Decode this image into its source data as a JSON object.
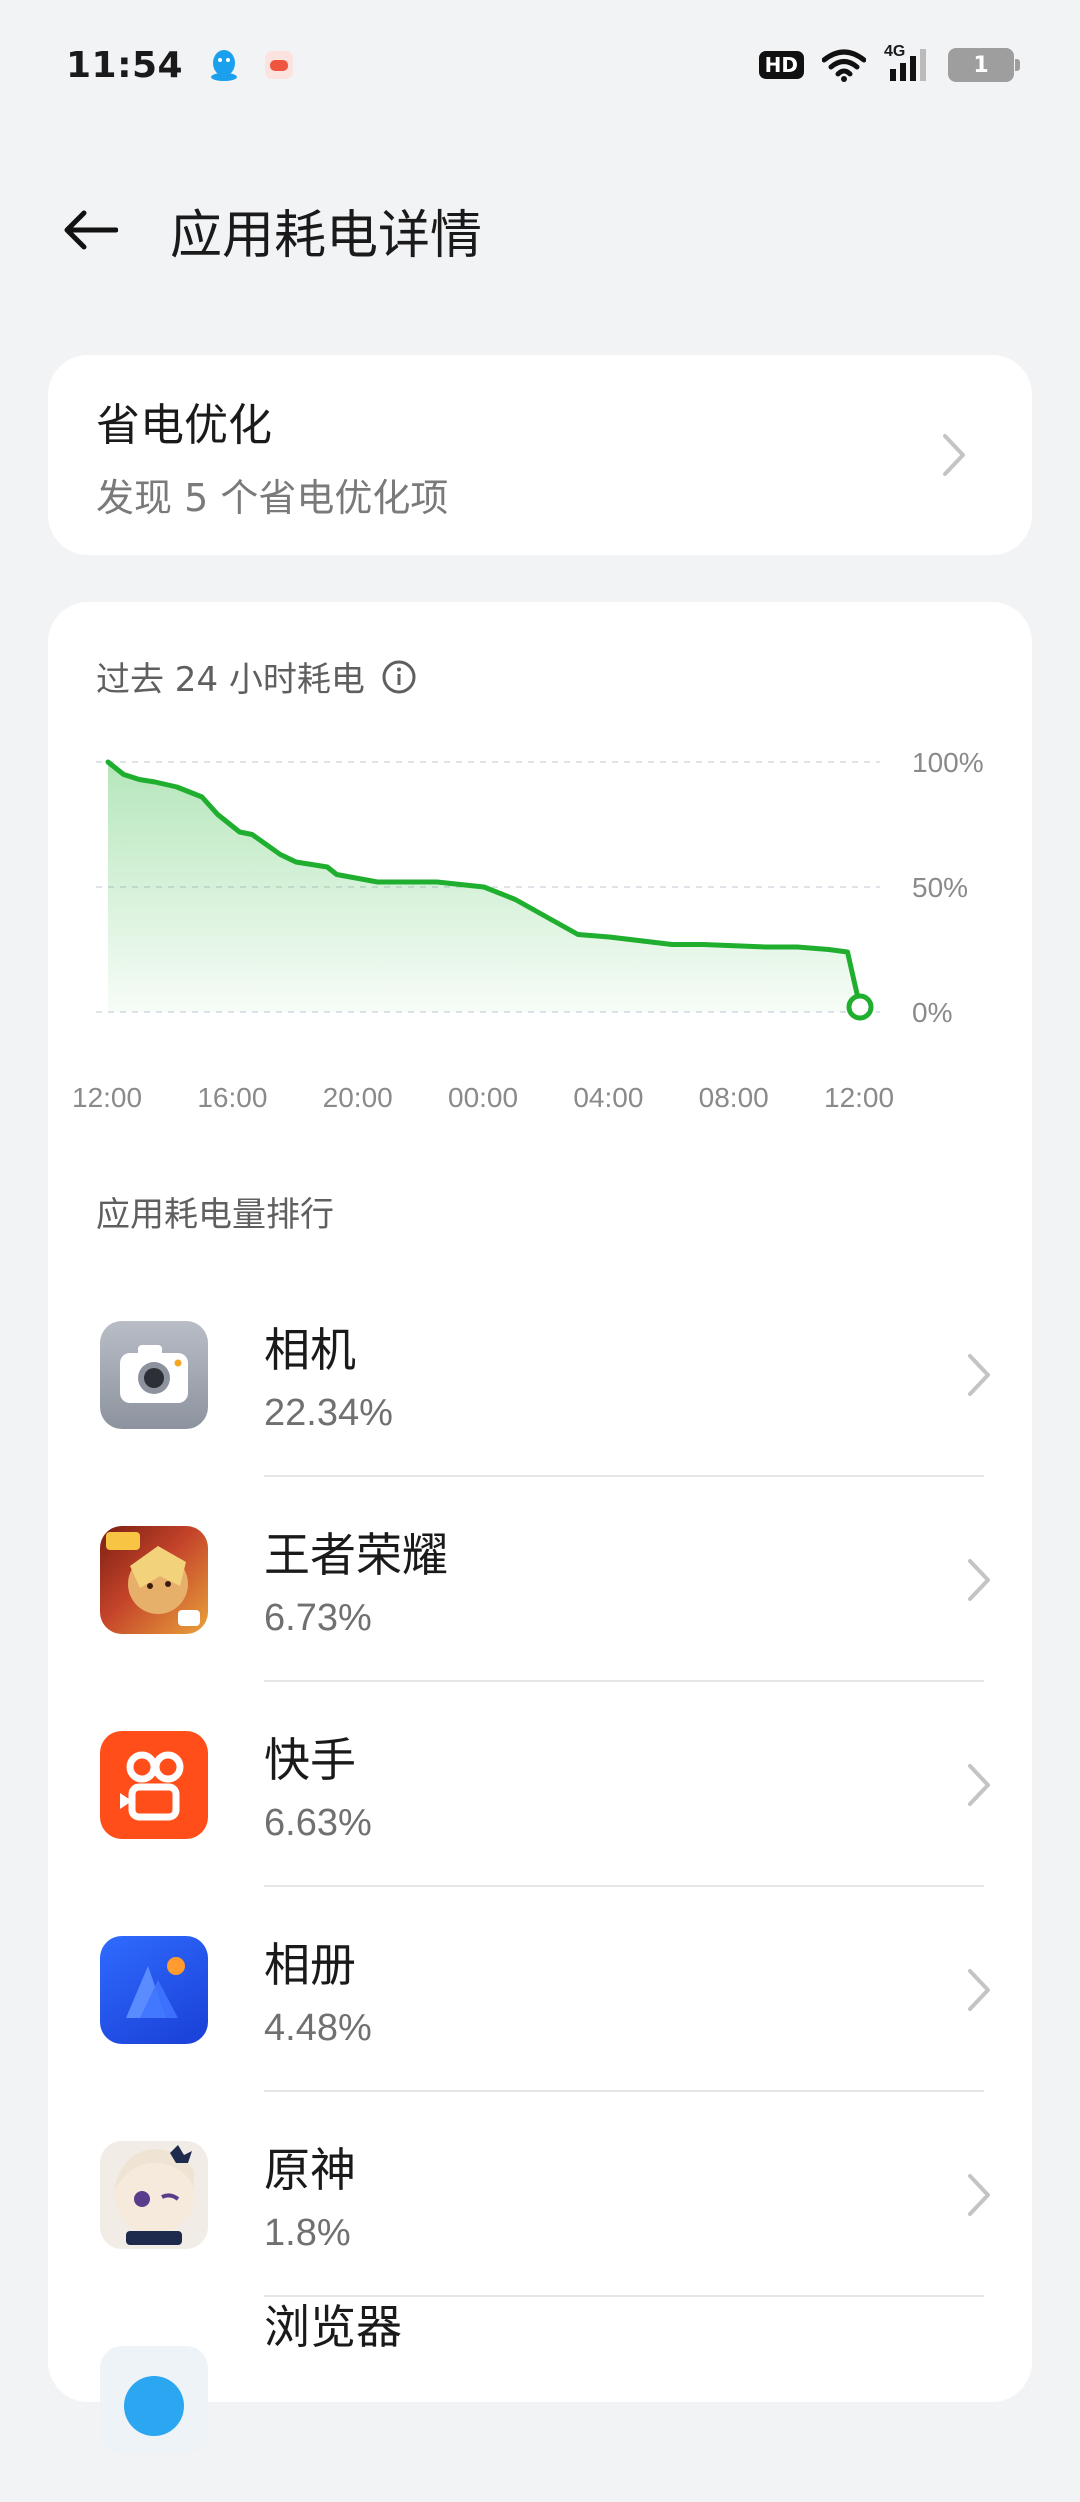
{
  "status_bar": {
    "time": "11:54",
    "hd": "HD",
    "network": "4G",
    "battery_level": "1",
    "icons": [
      "qq-icon",
      "game-app-icon",
      "wifi-icon",
      "signal-icon"
    ]
  },
  "header": {
    "title": "应用耗电详情",
    "back_icon": "back-arrow-icon"
  },
  "optimization": {
    "title": "省电优化",
    "subtitle": "发现 5 个省电优化项"
  },
  "usage": {
    "label": "过去 24 小时耗电",
    "info_icon": "info-icon"
  },
  "chart_data": {
    "type": "area",
    "x_ticks": [
      "12:00",
      "16:00",
      "20:00",
      "00:00",
      "04:00",
      "08:00",
      "12:00"
    ],
    "y_ticks": [
      "100%",
      "50%",
      "0%"
    ],
    "ylim": [
      0,
      100
    ],
    "xlim": [
      0,
      24
    ],
    "line_color": "#1fae2e",
    "grid": true,
    "series": [
      {
        "x": [
          0,
          0.5,
          1,
          1.5,
          2.2,
          3,
          3.5,
          4.2,
          4.6,
          5.5,
          6,
          7,
          7.3,
          8.6,
          9,
          9.6,
          10.5,
          12,
          13,
          15,
          16,
          18,
          19,
          21,
          22,
          23,
          23.6,
          24
        ],
        "y": [
          100,
          95,
          93,
          92,
          90,
          86,
          79,
          72,
          71,
          63,
          60,
          58,
          55,
          52,
          52,
          52,
          52,
          50,
          45,
          31,
          30,
          27,
          27,
          26,
          26,
          25,
          24,
          2
        ]
      }
    ]
  },
  "ranking": {
    "label": "应用耗电量排行",
    "apps": [
      {
        "name": "相机",
        "percent": "22.34%",
        "icon": "camera-icon"
      },
      {
        "name": "王者荣耀",
        "percent": "6.73%",
        "icon": "honor-of-kings-icon"
      },
      {
        "name": "快手",
        "percent": "6.63%",
        "icon": "kuaishou-icon"
      },
      {
        "name": "相册",
        "percent": "4.48%",
        "icon": "gallery-icon"
      },
      {
        "name": "原神",
        "percent": "1.8%",
        "icon": "genshin-icon"
      },
      {
        "name": "浏览器",
        "percent": "",
        "icon": "browser-icon"
      }
    ]
  },
  "colors": {
    "accent_green": "#1fae2e",
    "background": "#f2f3f5",
    "card": "#ffffff"
  }
}
